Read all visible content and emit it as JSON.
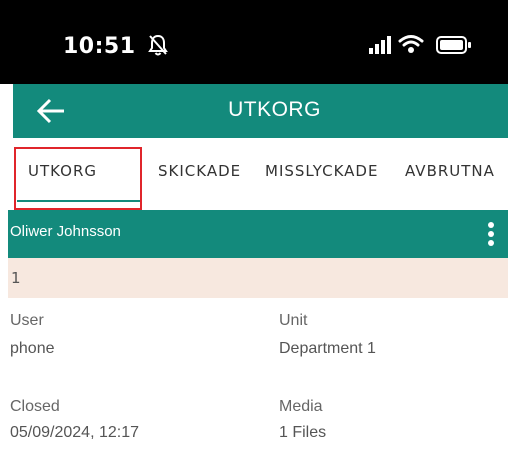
{
  "status_bar": {
    "time": "10:51",
    "icons": [
      "bell-slash-icon",
      "signal-icon",
      "wifi-icon",
      "battery-icon"
    ]
  },
  "app_bar": {
    "back_icon": "arrow-left-icon",
    "title": "UTKORG",
    "color": "#138a7c"
  },
  "tabs": [
    {
      "label": "UTKORG",
      "selected": true
    },
    {
      "label": "SKICKADE",
      "selected": false
    },
    {
      "label": "MISSLYCKADE",
      "selected": false
    },
    {
      "label": "AVBRUTNA",
      "selected": false
    }
  ],
  "highlight_color": "#e0252b",
  "card": {
    "name": "Oliwer Johnsson",
    "more_icon": "more-vertical-icon",
    "id": "1",
    "fields": {
      "user_label": "User",
      "user_value": "phone",
      "unit_label": "Unit",
      "unit_value": "Department 1",
      "closed_label": "Closed",
      "closed_value": "05/09/2024, 12:17",
      "media_label": "Media",
      "media_value": "1 Files"
    }
  }
}
